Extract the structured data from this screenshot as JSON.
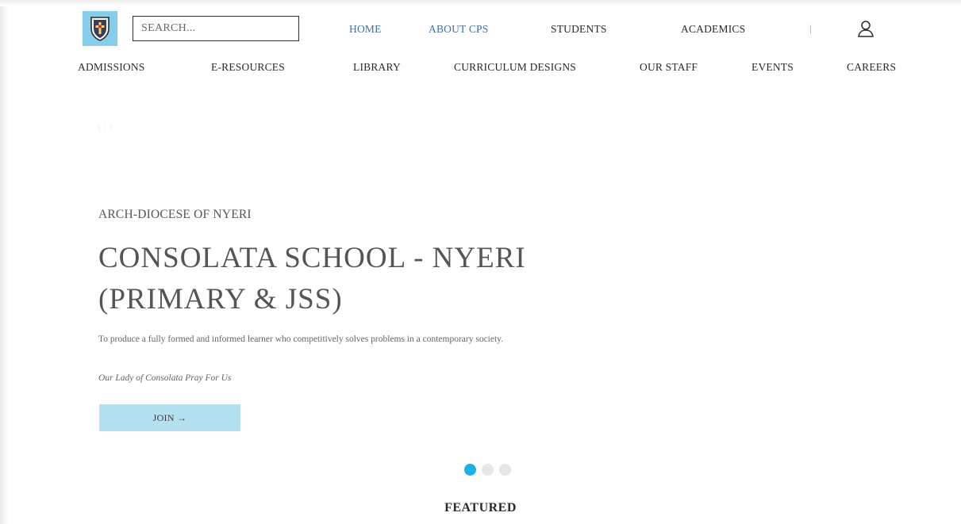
{
  "header": {
    "search": {
      "placeholder": "SEARCH..."
    },
    "top_nav": [
      {
        "label": "HOME",
        "color": "#3f6fa6"
      },
      {
        "label": "ABOUT CPS",
        "color": "#3f6fa6"
      },
      {
        "label": "STUDENTS"
      },
      {
        "label": "ACADEMICS"
      }
    ],
    "divider": "|",
    "user_icon": "user-icon",
    "sub_nav": [
      {
        "label": "ADMISSIONS"
      },
      {
        "label": "E-RESOURCES"
      },
      {
        "label": "LIBRARY"
      },
      {
        "label": "CURRICULUM DESIGNS"
      },
      {
        "label": "OUR STAFF"
      },
      {
        "label": "EVENTS"
      },
      {
        "label": "CAREERS"
      }
    ]
  },
  "hero": {
    "slide_counter": "1 / 3",
    "eyebrow": "ARCH-DIOCESE OF NYERI",
    "title_line1": "CONSOLATA SCHOOL - NYERI",
    "title_line2": "(PRIMARY & JSS)",
    "mission": "To produce a fully formed and informed learner who competitively solves problems in a contemporary society.",
    "motto": "Our Lady of Consolata Pray For Us",
    "join_label": "JOIN →",
    "join_color": "#b5e0f0"
  },
  "carousel": {
    "active_index": 0,
    "active_color": "#1faee9",
    "dots": 3
  },
  "featured_heading": "FEATURED",
  "colors": {
    "logo_bg": "#87ceeb",
    "nav_link_active": "#3f6fa6",
    "text_dark": "#2a2a2a"
  }
}
